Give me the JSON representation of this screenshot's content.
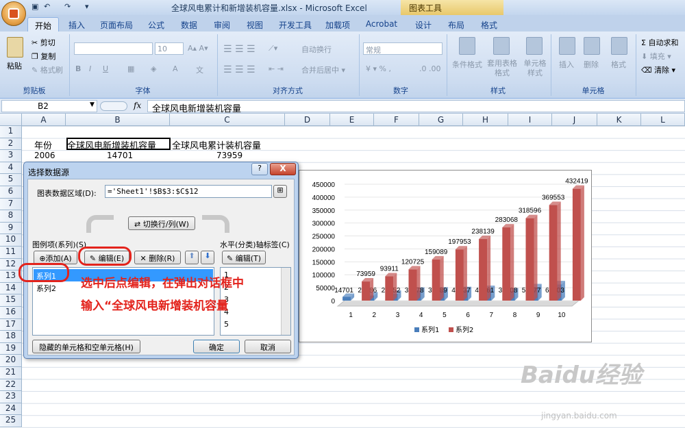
{
  "window": {
    "title": "全球风电累计和新增装机容量.xlsx - Microsoft Excel",
    "context_tab": "图表工具"
  },
  "tabs": [
    "开始",
    "插入",
    "页面布局",
    "公式",
    "数据",
    "审阅",
    "视图",
    "开发工具",
    "加载项",
    "Acrobat",
    "设计",
    "布局",
    "格式"
  ],
  "ribbon": {
    "clipboard": {
      "paste": "粘贴",
      "cut": "剪切",
      "copy": "复制",
      "format_painter": "格式刷",
      "label": "剪贴板"
    },
    "font": {
      "size": "10",
      "label": "字体"
    },
    "alignment": {
      "wrap": "自动换行",
      "merge": "合并后居中 ▾",
      "label": "对齐方式"
    },
    "number": {
      "format": "常规",
      "label": "数字"
    },
    "styles": {
      "conditional": "条件格式",
      "table": "套用表格格式",
      "cell": "单元格样式",
      "label": "样式"
    },
    "cells": {
      "insert": "插入",
      "delete": "删除",
      "format": "格式",
      "label": "单元格"
    },
    "editing": {
      "autosum": "Σ 自动求和",
      "fill": "填充 ▾",
      "clear": "清除 ▾"
    }
  },
  "formula_bar": {
    "name_box": "B2",
    "fx": "fx",
    "formula": "全球风电新增装机容量"
  },
  "columns": [
    "A",
    "B",
    "C",
    "D",
    "E",
    "F",
    "G",
    "H",
    "I",
    "J",
    "K",
    "L"
  ],
  "rows": [
    "1",
    "2",
    "3",
    "4",
    "5",
    "6",
    "7",
    "8",
    "9",
    "10",
    "11",
    "12",
    "13",
    "14",
    "15",
    "16",
    "17",
    "18",
    "19",
    "20",
    "21",
    "22",
    "23",
    "24",
    "25"
  ],
  "cells": {
    "a2": "年份",
    "b2": "全球风电新增装机容量",
    "c2": "全球风电累计装机容量",
    "a3": "2006",
    "b3": "14701",
    "c3": "73959"
  },
  "dialog": {
    "title": "选择数据源",
    "help": "?",
    "close": "X",
    "range_label": "图表数据区域(D):",
    "range_value": "='Sheet1'!$B$3:$C$12",
    "switch": "切换行/列(W)",
    "series_label": "图例项(系列)(S)",
    "axis_label": "水平(分类)轴标签(C)",
    "add": "添加(A)",
    "edit": "编辑(E)",
    "remove": "删除(R)",
    "axis_edit": "编辑(T)",
    "series": [
      "系列1",
      "系列2"
    ],
    "axis_items": [
      "1",
      "2",
      "3",
      "4",
      "5"
    ],
    "hidden_cells": "隐藏的单元格和空单元格(H)",
    "ok": "确定",
    "cancel": "取消"
  },
  "annotation": {
    "line1": "选中后点编辑，在弹出对话框中",
    "line2": "输入“全球风电新增装机容量"
  },
  "watermark": {
    "logo": "Baidu经验",
    "url": "jingyan.baidu.com"
  },
  "chart_data": {
    "type": "bar",
    "categories": [
      "1",
      "2",
      "3",
      "4",
      "5",
      "6",
      "7",
      "8",
      "9",
      "10"
    ],
    "series": [
      {
        "name": "系列1",
        "color": "#4a7ebb",
        "values": [
          14701,
          20286,
          26952,
          38478,
          38989,
          40637,
          45161,
          35708,
          51477,
          63103
        ]
      },
      {
        "name": "系列2",
        "color": "#c0504d",
        "values": [
          73959,
          93911,
          120725,
          159089,
          197953,
          238139,
          283068,
          318596,
          369553,
          432419
        ]
      }
    ],
    "yticks": [
      "0",
      "50000",
      "100000",
      "150000",
      "200000",
      "250000",
      "300000",
      "350000",
      "400000",
      "450000"
    ],
    "ylim": [
      0,
      450000
    ],
    "legend": "bottom"
  }
}
